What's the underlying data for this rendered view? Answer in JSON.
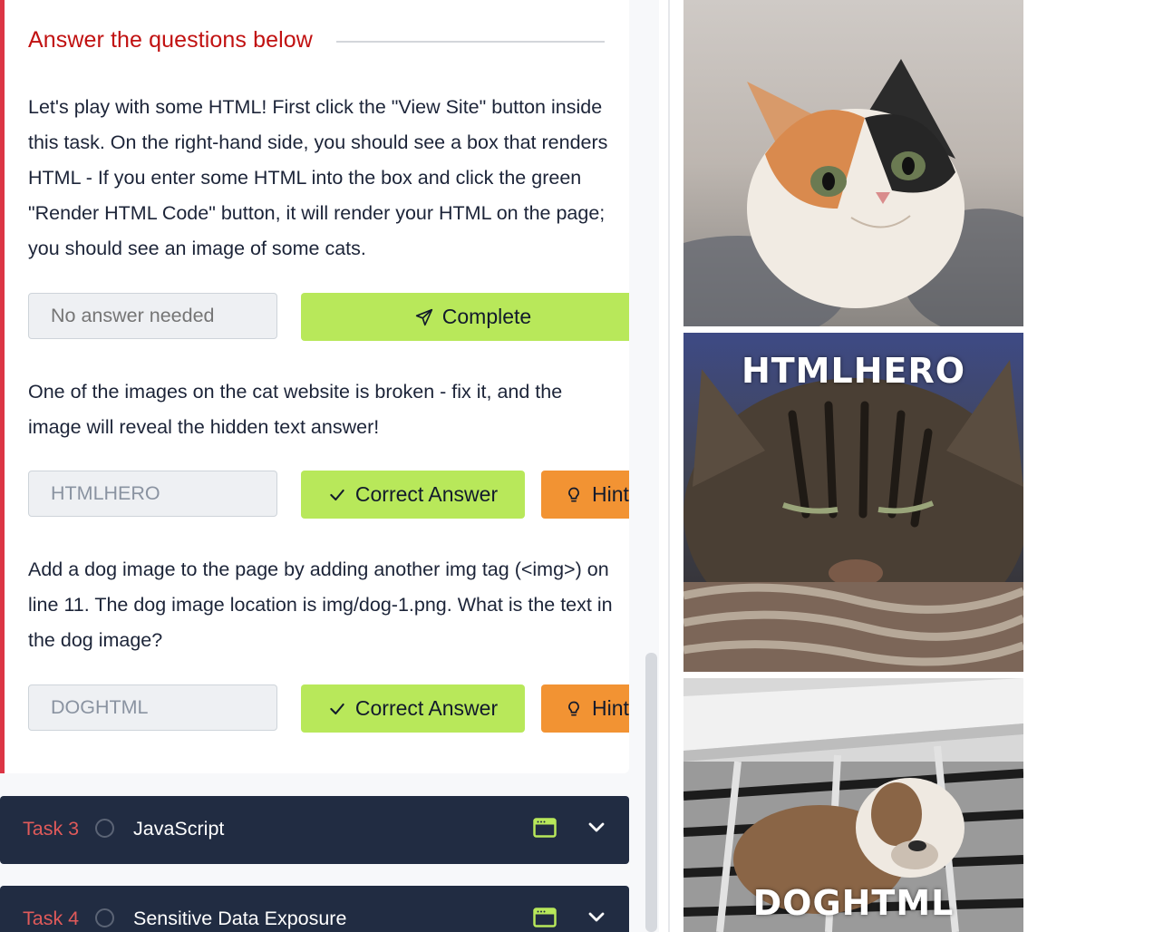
{
  "task": {
    "section_title": "Answer the questions below",
    "questions": [
      {
        "text": "Let's play with some HTML! First click the \"View Site\" button inside this task. On the right-hand side, you should see a box that renders HTML - If you enter some HTML into the box and click the green \"Render HTML Code\" button, it will render your HTML on the page; you should see an image of some cats.",
        "answer_placeholder": "No answer needed",
        "submit_label": "Complete"
      },
      {
        "text": "One of the images on the cat website is broken - fix it, and the image will reveal the hidden text answer!",
        "answer_value": "HTMLHERO",
        "submit_label": "Correct Answer",
        "hint_label": "Hint"
      },
      {
        "text": "Add a dog image to the page by adding another img tag (<img>) on line 11. The dog image location is img/dog-1.png. What is the text in the dog image?",
        "answer_value": "DOGHTML",
        "submit_label": "Correct Answer",
        "hint_label": "Hint"
      }
    ]
  },
  "tasks": [
    {
      "number": "Task 3",
      "title": "JavaScript",
      "icon": "browser-window-icon"
    },
    {
      "number": "Task 4",
      "title": "Sensitive Data Exposure",
      "icon": "browser-window-icon"
    }
  ],
  "site_preview": {
    "images": [
      {
        "name": "kitten-image",
        "caption": ""
      },
      {
        "name": "tabby-cat-image",
        "caption": "HTMLHERO"
      },
      {
        "name": "bulldog-image",
        "caption": "DOGHTML"
      }
    ]
  },
  "colors": {
    "accent_red": "#dc3545",
    "button_green": "#b8e85a",
    "button_orange": "#f29333",
    "task_bar": "#212c42"
  }
}
